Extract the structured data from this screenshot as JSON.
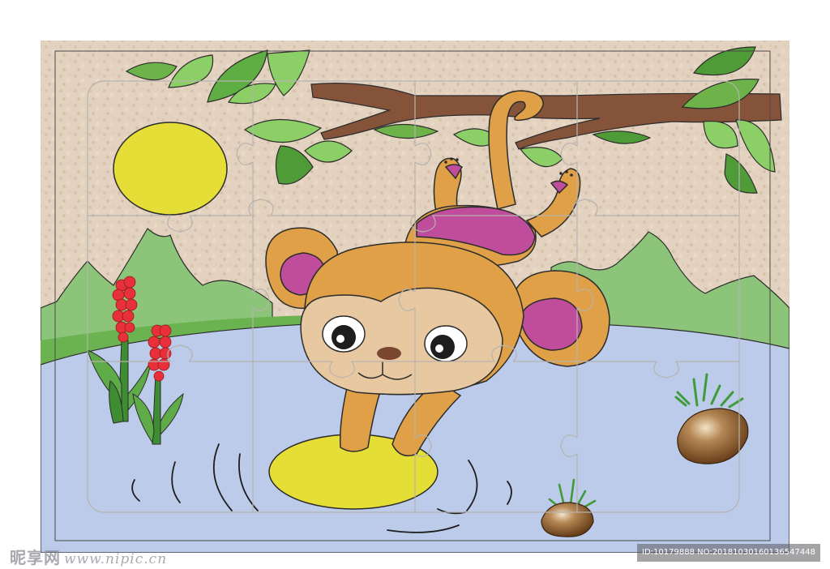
{
  "watermark": {
    "brand": "昵享网",
    "url": "www.nipic.cn",
    "id_text": "ID:10179888 NO:20181030160136547448"
  },
  "colors": {
    "sky": "#e2d2bf",
    "sun": "#e4de36",
    "hills": "#8cc47a",
    "grass": "#6bb250",
    "pond": "#bccbe9",
    "branch": "#85523a",
    "leaf": "#7dc159",
    "monkey_fur": "#e0a047",
    "monkey_face": "#e8c8a0",
    "monkey_ear_inner": "#c04d9c",
    "lilypad": "#e4de36",
    "flower": "#e8303a",
    "stone": "#8a5a2c"
  },
  "icons": [
    "monkey-icon",
    "sun-icon",
    "branch-icon",
    "leaf-icon",
    "flower-icon",
    "stone-icon",
    "lilypad-icon"
  ]
}
